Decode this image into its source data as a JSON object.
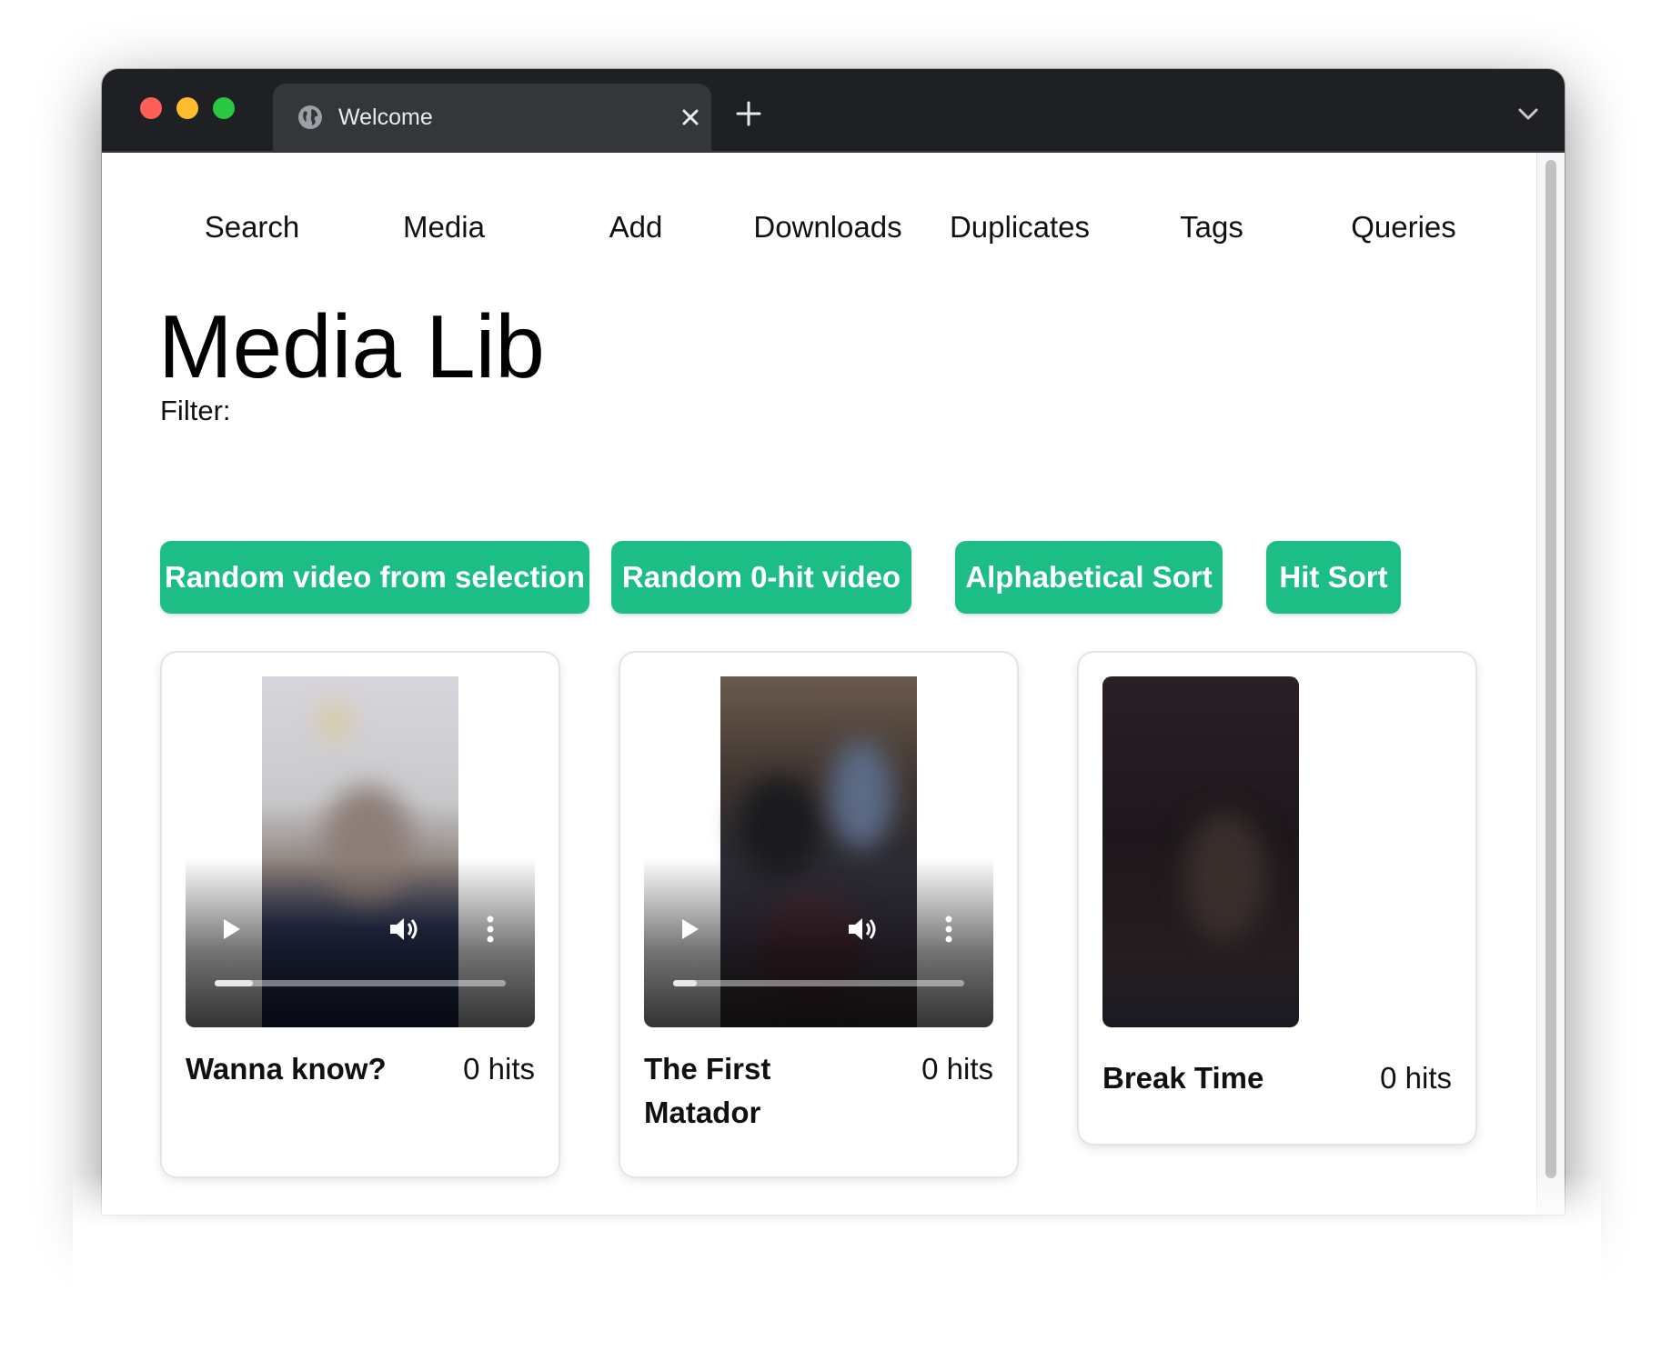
{
  "browser": {
    "tab_title": "Welcome"
  },
  "nav": {
    "items": [
      {
        "label": "Search"
      },
      {
        "label": "Media"
      },
      {
        "label": "Add"
      },
      {
        "label": "Downloads"
      },
      {
        "label": "Duplicates"
      },
      {
        "label": "Tags"
      },
      {
        "label": "Queries"
      }
    ]
  },
  "page": {
    "title": "Media Lib",
    "filter_label": "Filter:"
  },
  "actions": {
    "random_selection": "Random video from selection",
    "random_zero_hit": "Random 0-hit video",
    "alpha_sort": "Alphabetical Sort",
    "hit_sort": "Hit Sort"
  },
  "colors": {
    "accent": "#1dbe86",
    "titlebar": "#1f2023",
    "tab": "#35363a"
  },
  "media": [
    {
      "title": "Wanna know?",
      "hits": "0 hits",
      "has_controls": true,
      "progress": 0.13
    },
    {
      "title": "The First Matador",
      "hits": "0 hits",
      "has_controls": true,
      "progress": 0.08
    },
    {
      "title": "Break Time",
      "hits": "0 hits",
      "has_controls": false
    }
  ]
}
